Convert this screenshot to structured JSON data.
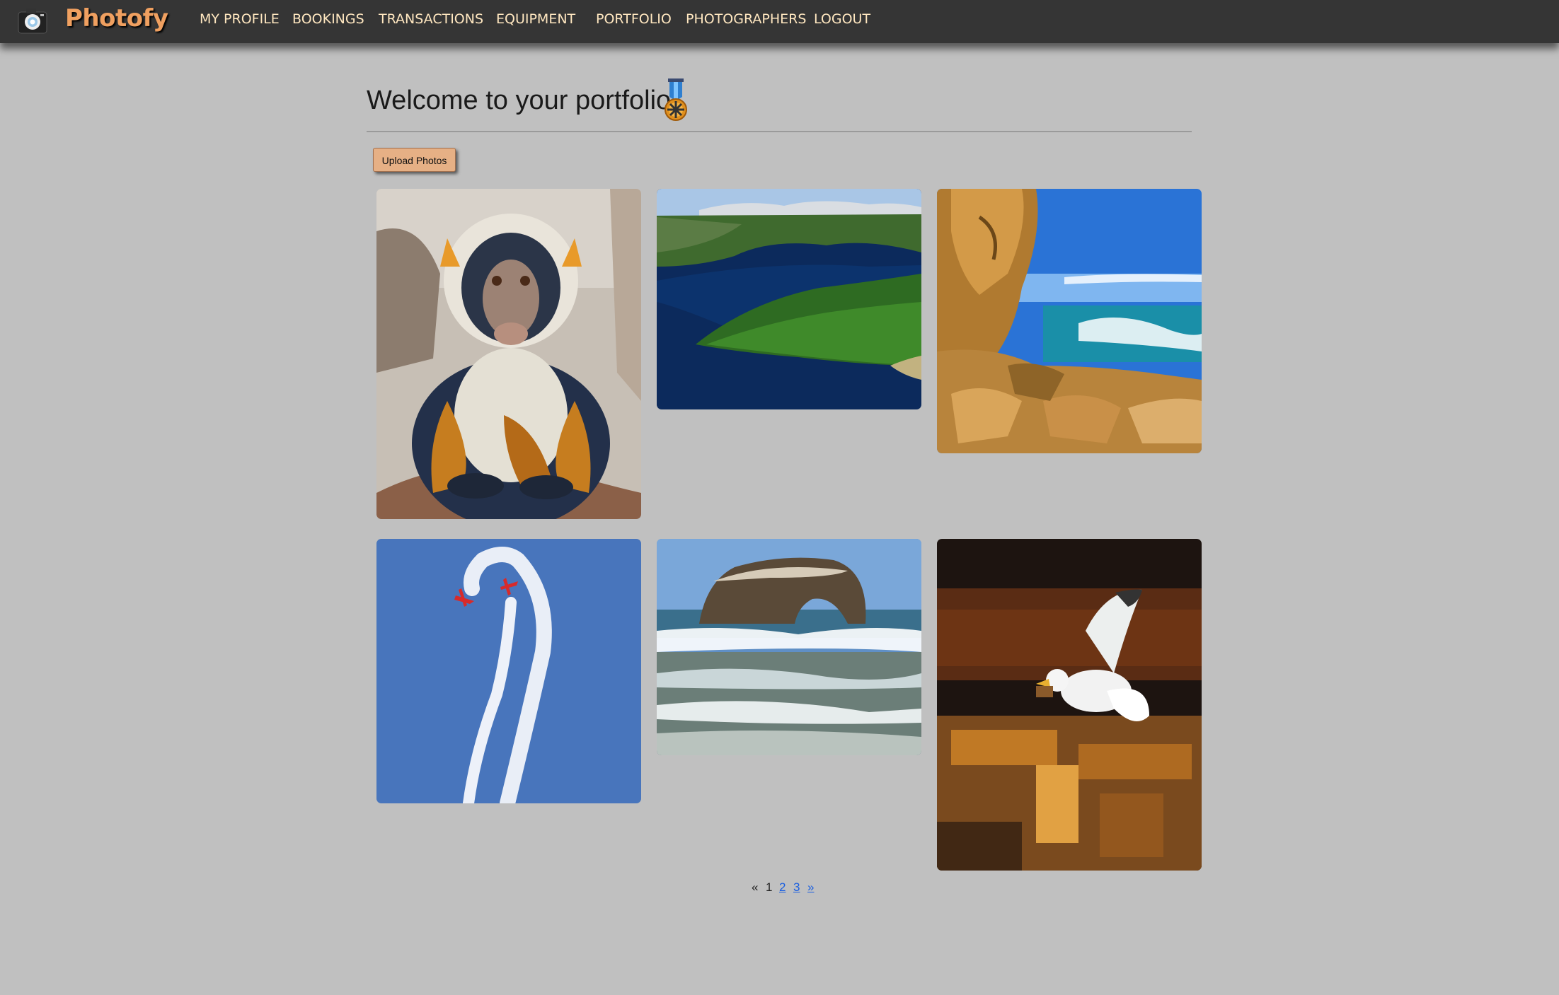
{
  "app": {
    "name": "Photofy"
  },
  "nav": {
    "items": [
      {
        "label": "MY PROFILE"
      },
      {
        "label": "BOOKINGS"
      },
      {
        "label": "TRANSACTIONS"
      },
      {
        "label": "EQUIPMENT"
      },
      {
        "label": "PORTFOLIO"
      },
      {
        "label": "PHOTOGRAPHERS"
      },
      {
        "label": "LOGOUT"
      }
    ]
  },
  "page": {
    "title": "Welcome to your portfolio",
    "upload_label": "Upload Photos"
  },
  "gallery": {
    "photos": [
      {
        "subject": "monkey-photo"
      },
      {
        "subject": "lake-forest-photo"
      },
      {
        "subject": "coastal-cliff-photo"
      },
      {
        "subject": "airshow-planes-photo"
      },
      {
        "subject": "sea-arch-rock-photo"
      },
      {
        "subject": "seagull-photo"
      }
    ]
  },
  "pagination": {
    "prev": "«",
    "current": "1",
    "pages": [
      "2",
      "3"
    ],
    "next": "»"
  },
  "colors": {
    "navbar": "#353535",
    "brand": "#f0a060",
    "nav_text": "#ffe7c0",
    "background": "#c0c0c0",
    "button": "#e6b085",
    "link": "#1a5fe0"
  }
}
